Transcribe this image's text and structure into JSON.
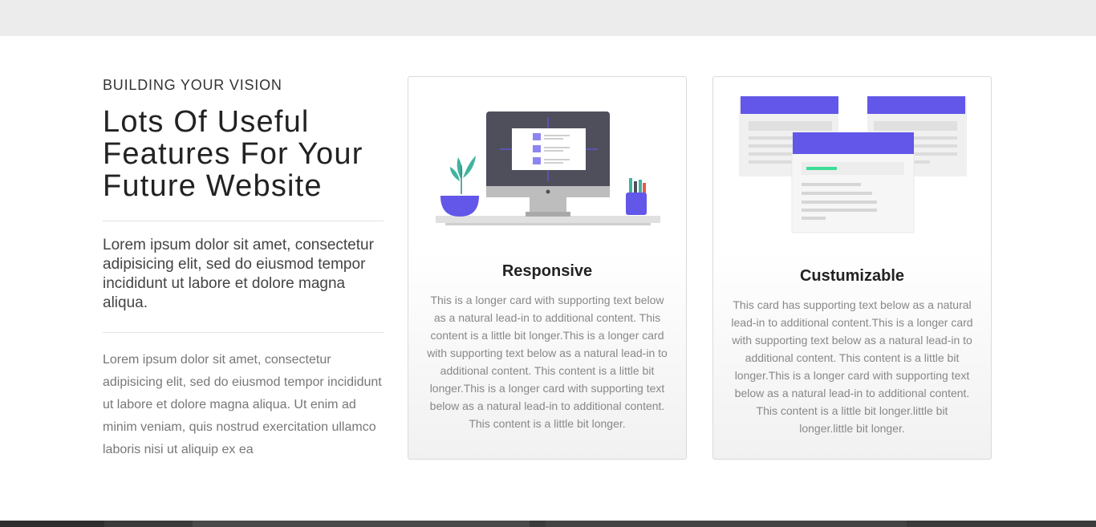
{
  "intro": {
    "eyebrow": "BUILDING YOUR VISION",
    "headline_line1": "Lots Of Useful",
    "headline_line2": "Features For Your",
    "headline_line3": "Future Website",
    "lead": "Lorem ipsum dolor sit amet, consectetur adipisicing elit, sed do eiusmod tempor incididunt ut labore et dolore magna aliqua.",
    "body": "Lorem ipsum dolor sit amet, consectetur adipisicing elit, sed do eiusmod tempor incididunt ut labore et dolore magna aliqua. Ut enim ad minim veniam, quis nostrud exercitation ullamco laboris nisi ut aliquip ex ea"
  },
  "cards": [
    {
      "title": "Responsive",
      "text": "This is a longer card with supporting text below as a natural lead-in to additional content. This content is a little bit longer.This is a longer card with supporting text below as a natural lead-in to additional content. This content is a little bit longer.This is a longer card with supporting text below as a natural lead-in to additional content. This content is a little bit longer.",
      "icon": "desktop-monitor-illustration"
    },
    {
      "title": "Custumizable",
      "text": "This card has supporting text below as a natural lead-in to additional content.This is a longer card with supporting text below as a natural lead-in to additional content. This content is a little bit longer.This is a longer card with supporting text below as a natural lead-in to additional content. This content is a little bit longer.little bit longer.little bit longer.",
      "icon": "layout-windows-illustration"
    }
  ],
  "colors": {
    "accent": "#6257e8",
    "teal": "#3fb3a0",
    "green": "#3ddc97",
    "monitor": "#4f4f5c",
    "top_band": "#ececec",
    "bottom_band": "#3b3b3b"
  }
}
